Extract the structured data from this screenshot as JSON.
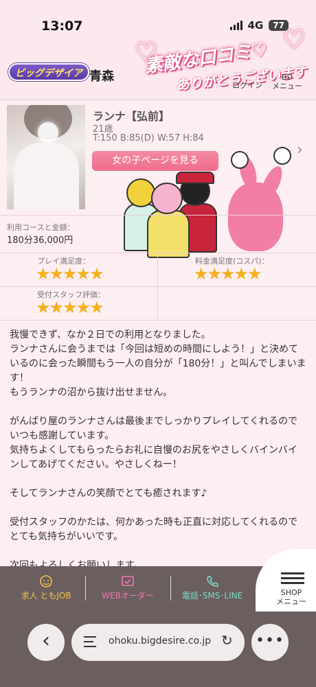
{
  "status": {
    "time": "13:07",
    "network": "4G",
    "battery": "77"
  },
  "header": {
    "logo": "ビッグデザイア",
    "region": "青森",
    "banner_line1": "素敵な口コミ♡",
    "banner_line2": "ありがとうございます",
    "login": "ログイン",
    "menu_top": "BD",
    "menu_bottom": "メニュー"
  },
  "profile": {
    "name": "ランナ【弘前】",
    "age": "21歳",
    "size": "T:150 B:85(D) W:57 H:84",
    "button": "女の子ページを見る"
  },
  "course": {
    "label": "利用コースと金額：",
    "value": "180分36,000円"
  },
  "ratings": [
    {
      "label": "プレイ満足度：",
      "stars": "★★★★★",
      "score": 5
    },
    {
      "label": "料金満足度(コスパ)：",
      "stars": "★★★★★",
      "score": 5
    },
    {
      "label": "受付スタッフ評価：",
      "stars": "★★★★★",
      "score": 5
    }
  ],
  "review": "我慢できず、なか２日での利用となりました。\nランナさんに会うまでは「今回は短めの時間にしよう！」と決めているのに会った瞬間もう一人の自分が「180分！」と叫んでしまいます！\nもうランナの沼から抜け出せません。\n\nがんばり屋のランナさんは最後までしっかりプレイしてくれるのでいつも感謝しています。\n気持ちよくしてもらったらお礼に自慢のお尻をやさしくバインバインしてあげてください。やさしくねー！\n\nそしてランナさんの笑顔でとても癒されます♪\n\n受付スタッフのかたは、何かあった時も正直に対応してくれるのでとても気持ちがいいです。\n\n次回もよろしくお願いします。",
  "bottom_bar": {
    "job": "求人 ともJOB",
    "web_order": "WEBオーダー",
    "contact": "電話･SMS･LINE",
    "shop": "SHOP",
    "shop_menu": "メニュー"
  },
  "browser": {
    "url": "ohoku.bigdesire.co.jp"
  },
  "colors": {
    "accent": "#ee6c8b",
    "star": "#f5b01a",
    "bar": "#6b5e5f",
    "job": "#f5c542",
    "web": "#f07ab0",
    "contact": "#7fdcc8"
  }
}
